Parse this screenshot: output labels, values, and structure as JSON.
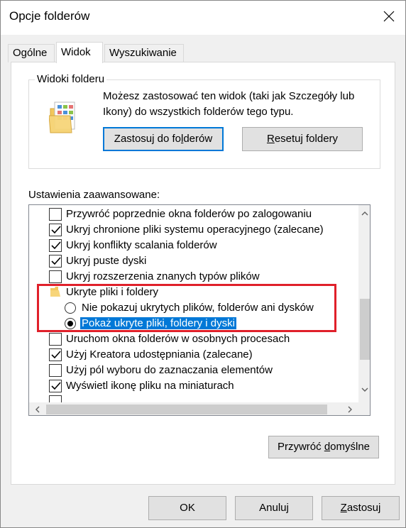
{
  "window": {
    "title": "Opcje folderów",
    "close_icon": "close-icon"
  },
  "tabs": [
    {
      "label_pre": "O",
      "label_ul": "g",
      "label_post": "ólne"
    },
    {
      "label": "Widok",
      "active": true
    },
    {
      "label": "Wyszukiwanie"
    }
  ],
  "folder_views": {
    "legend": "Widoki folderu",
    "description": "Możesz zastosować ten widok (taki jak Szczegóły lub Ikony) do wszystkich folderów tego typu.",
    "apply_button": {
      "pre": "Zastosuj do fo",
      "ul": "l",
      "post": "derów"
    },
    "reset_button": {
      "pre": "",
      "ul": "R",
      "post": "esetuj foldery"
    }
  },
  "advanced": {
    "label": "Ustawienia zaawansowane:",
    "items": [
      {
        "text": "Przywróć poprzednie okna folderów po zalogowaniu",
        "type": "checkbox",
        "checked": false
      },
      {
        "text": "Ukryj chronione pliki systemu operacyjnego (zalecane)",
        "type": "checkbox",
        "checked": true
      },
      {
        "text": "Ukryj konflikty scalania folderów",
        "type": "checkbox",
        "checked": true
      },
      {
        "text": "Ukryj puste dyski",
        "type": "checkbox",
        "checked": true
      },
      {
        "text": "Ukryj rozszerzenia znanych typów plików",
        "type": "checkbox",
        "checked": false
      },
      {
        "text": "Ukryte pliki i foldery",
        "type": "folder"
      },
      {
        "text": "Nie pokazuj ukrytych plików, folderów ani dysków",
        "type": "radio",
        "checked": false
      },
      {
        "text": "Pokaż ukryte pliki, foldery i dyski",
        "type": "radio",
        "checked": true,
        "selected": true
      },
      {
        "text": "Uruchom okna folderów w osobnych procesach",
        "type": "checkbox",
        "checked": false
      },
      {
        "text": "Użyj Kreatora udostępniania (zalecane)",
        "type": "checkbox",
        "checked": true
      },
      {
        "text": "Użyj pól wyboru do zaznaczania elementów",
        "type": "checkbox",
        "checked": false
      },
      {
        "text": "Wyświetl ikonę pliku na miniaturach",
        "type": "checkbox",
        "checked": true
      }
    ]
  },
  "restore_defaults": {
    "pre": "Przywróć ",
    "ul": "d",
    "post": "omyślne"
  },
  "footer": {
    "ok": "OK",
    "cancel": "Anuluj",
    "apply": {
      "pre": "",
      "ul": "Z",
      "post": "astosuj"
    }
  },
  "colors": {
    "selection": "#0078d7",
    "highlight_border": "#e0202a",
    "accent": "#0078d7"
  }
}
